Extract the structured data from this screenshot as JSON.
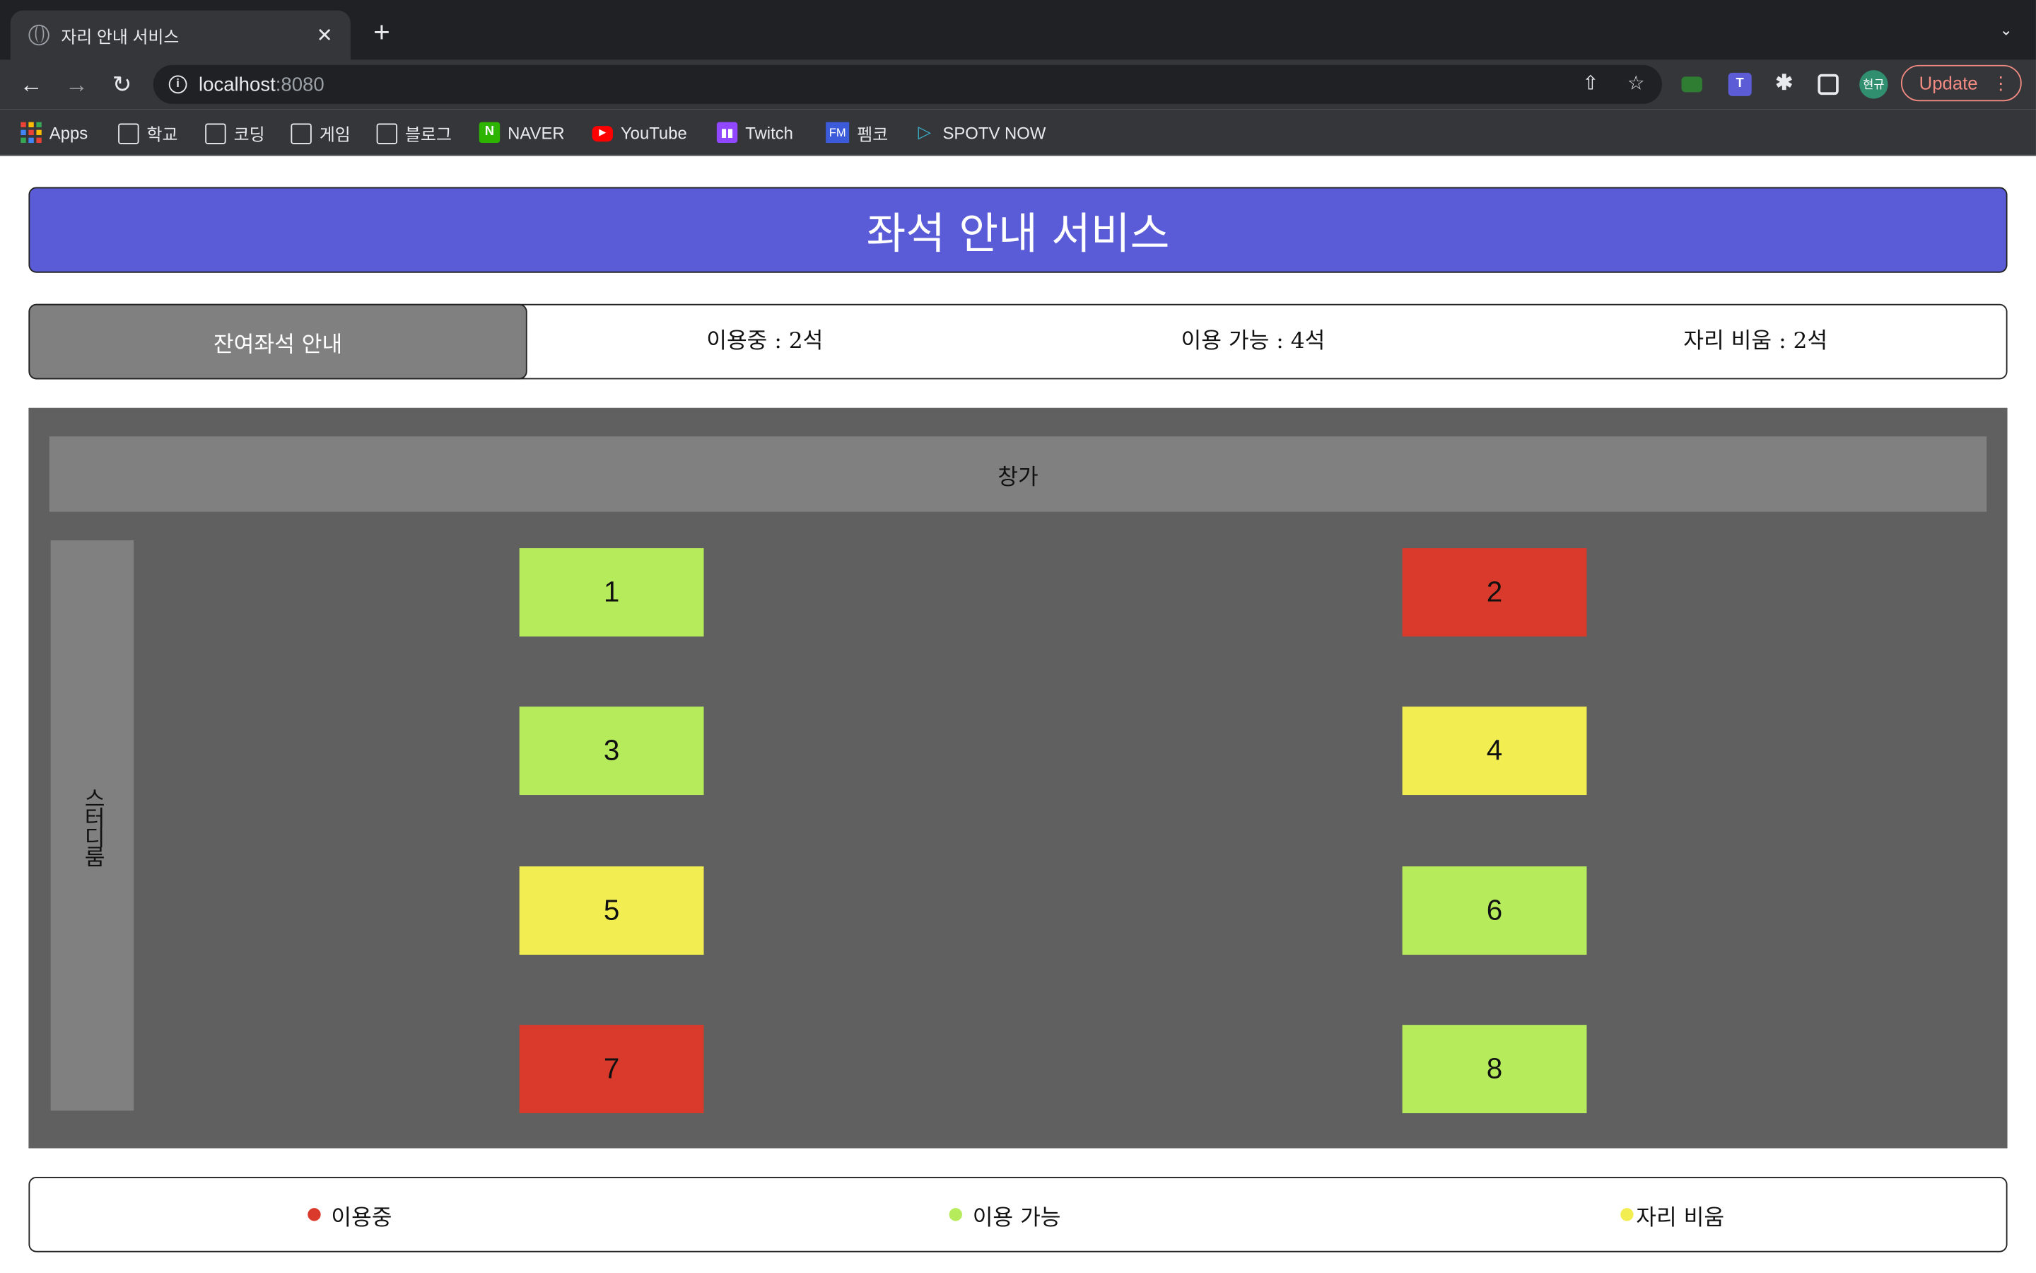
{
  "browser": {
    "tab_title": "자리 안내 서비스",
    "tab_close": "✕",
    "new_tab": "+",
    "tab_menu": "⌄",
    "url_host": "localhost",
    "url_port": ":8080",
    "update_label": "Update",
    "avatar_text": "현규",
    "bookmarks": [
      {
        "label": "Apps",
        "icon": "apps-grid-icon"
      },
      {
        "label": "학교",
        "icon": "folder-icon"
      },
      {
        "label": "코딩",
        "icon": "folder-icon"
      },
      {
        "label": "게임",
        "icon": "folder-icon"
      },
      {
        "label": "블로그",
        "icon": "folder-icon"
      },
      {
        "label": "NAVER",
        "icon": "naver-icon",
        "color": "#2db400"
      },
      {
        "label": "YouTube",
        "icon": "youtube-icon",
        "color": "#ff0000"
      },
      {
        "label": "Twitch",
        "icon": "twitch-icon",
        "color": "#9146ff"
      },
      {
        "label": "펨코",
        "icon": "fmkorea-icon",
        "color": "#3b5bdb"
      },
      {
        "label": "SPOTV NOW",
        "icon": "spotv-play-icon",
        "color": "#3ab0c8"
      }
    ]
  },
  "page": {
    "title": "좌석 안내 서비스",
    "stats": {
      "tab_label": "잔여좌석 안내",
      "in_use": "이용중 : 2석",
      "available": "이용 가능 : 4석",
      "away": "자리 비움 : 2석"
    },
    "room": {
      "window_label": "창가",
      "study_room_label": "스터디룸",
      "seats": [
        {
          "number": "1",
          "status": "available"
        },
        {
          "number": "2",
          "status": "in_use"
        },
        {
          "number": "3",
          "status": "available"
        },
        {
          "number": "4",
          "status": "away"
        },
        {
          "number": "5",
          "status": "away"
        },
        {
          "number": "6",
          "status": "available"
        },
        {
          "number": "7",
          "status": "in_use"
        },
        {
          "number": "8",
          "status": "available"
        }
      ]
    },
    "legend": {
      "in_use": "이용중",
      "available": "이용 가능",
      "away": "자리 비움"
    }
  },
  "colors": {
    "header": "#5a5bd6",
    "in_use": "#d93a2b",
    "available": "#b6ec5c",
    "away": "#f2ee52",
    "room_bg": "#606060",
    "panel_gray": "#808080"
  }
}
